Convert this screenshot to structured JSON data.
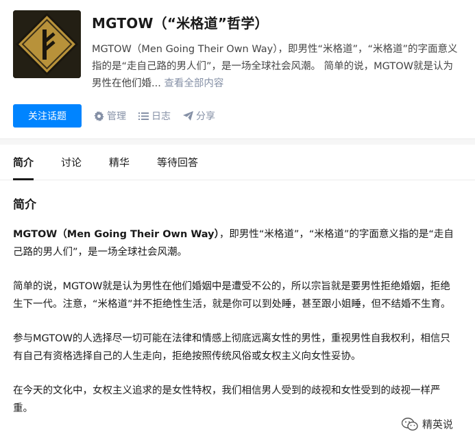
{
  "topic": {
    "title": "MGTOW（“米格道”哲学）",
    "description": "MGTOW（Men Going Their Own Way），即男性“米格道”，“米格道”的字面意义指的是“走自己路的男人们”，是一场全球社会风潮。 简单的说，MGTOW就是认为男性在他们婚...",
    "more_link": "查看全部内容"
  },
  "actions": {
    "follow": "关注话题",
    "manage": "管理",
    "log": "日志",
    "share": "分享"
  },
  "tabs": [
    "简介",
    "讨论",
    "精华",
    "等待回答"
  ],
  "content": {
    "section_title": "简介",
    "p1_bold": "MGTOW（Men Going Their Own Way）",
    "p1_rest": "，即男性“米格道”，“米格道”的字面意义指的是“走自己路的男人们”，是一场全球社会风潮。",
    "p2": "简单的说，MGTOW就是认为男性在他们婚姻中是遭受不公的，所以宗旨就是要男性拒绝婚姻，拒绝生下一代。注意，“米格道”并不拒绝性生活，就是你可以到处睡，甚至跟小姐睡，但不结婚不生育。",
    "p3": "参与MGTOW的人选择尽一切可能在法律和情感上彻底远离女性的男性，重视男性自我权利，相信只有自己有资格选择自己的人生走向，拒绝按照传统风俗或女权主义向女性妥协。",
    "p4": "在今天的文化中，女权主义追求的是女性特权，我们相信男人受到的歧视和女性受到的歧视一样严重。"
  },
  "watermark": "精英说",
  "colors": {
    "primary": "#0084ff",
    "muted": "#8590a6",
    "logo_gold": "#b8923a"
  }
}
